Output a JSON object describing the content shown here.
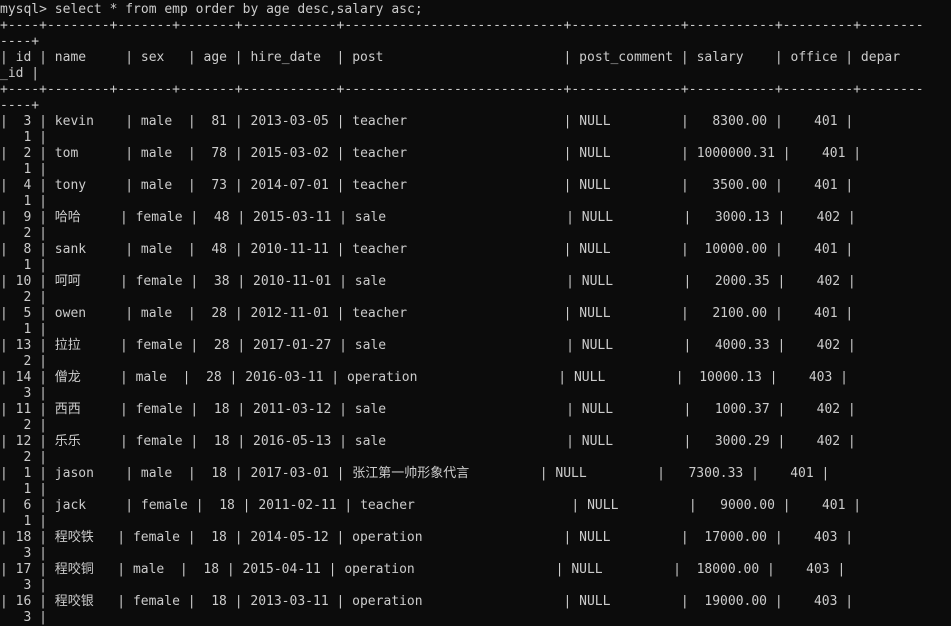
{
  "terminal": {
    "bg": "#0c0c0c",
    "fg": "#cccccc",
    "command": "mysql> select * from emp order by age desc,salary asc;"
  },
  "table": {
    "border_top": "+----+--------+-------+-------+------------+----------------------------+--------------+-----------+---------+--------",
    "border_wrap": "----+",
    "header": {
      "line1": "| id | name     | sex   | age | hire_date  | post                       | post_comment | salary    | office | depar",
      "line2": "_id |"
    },
    "rows": [
      {
        "id": "3",
        "name": "kevin",
        "sex": "male",
        "age": "81",
        "hire_date": "2013-03-05",
        "post": "teacher",
        "post_comment": "NULL",
        "salary": "8300.00",
        "office": "401",
        "depart_id": "1"
      },
      {
        "id": "2",
        "name": "tom",
        "sex": "male",
        "age": "78",
        "hire_date": "2015-03-02",
        "post": "teacher",
        "post_comment": "NULL",
        "salary": "1000000.31",
        "office": "401",
        "depart_id": "1"
      },
      {
        "id": "4",
        "name": "tony",
        "sex": "male",
        "age": "73",
        "hire_date": "2014-07-01",
        "post": "teacher",
        "post_comment": "NULL",
        "salary": "3500.00",
        "office": "401",
        "depart_id": "1"
      },
      {
        "id": "9",
        "name": "哈哈",
        "sex": "female",
        "age": "48",
        "hire_date": "2015-03-11",
        "post": "sale",
        "post_comment": "NULL",
        "salary": "3000.13",
        "office": "402",
        "depart_id": "2"
      },
      {
        "id": "8",
        "name": "sank",
        "sex": "male",
        "age": "48",
        "hire_date": "2010-11-11",
        "post": "teacher",
        "post_comment": "NULL",
        "salary": "10000.00",
        "office": "401",
        "depart_id": "1"
      },
      {
        "id": "10",
        "name": "呵呵",
        "sex": "female",
        "age": "38",
        "hire_date": "2010-11-01",
        "post": "sale",
        "post_comment": "NULL",
        "salary": "2000.35",
        "office": "402",
        "depart_id": "2"
      },
      {
        "id": "5",
        "name": "owen",
        "sex": "male",
        "age": "28",
        "hire_date": "2012-11-01",
        "post": "teacher",
        "post_comment": "NULL",
        "salary": "2100.00",
        "office": "401",
        "depart_id": "1"
      },
      {
        "id": "13",
        "name": "拉拉",
        "sex": "female",
        "age": "28",
        "hire_date": "2017-01-27",
        "post": "sale",
        "post_comment": "NULL",
        "salary": "4000.33",
        "office": "402",
        "depart_id": "2"
      },
      {
        "id": "14",
        "name": "僧龙",
        "sex": "male",
        "age": "28",
        "hire_date": "2016-03-11",
        "post": "operation",
        "post_comment": "NULL",
        "salary": "10000.13",
        "office": "403",
        "depart_id": "3"
      },
      {
        "id": "11",
        "name": "西西",
        "sex": "female",
        "age": "18",
        "hire_date": "2011-03-12",
        "post": "sale",
        "post_comment": "NULL",
        "salary": "1000.37",
        "office": "402",
        "depart_id": "2"
      },
      {
        "id": "12",
        "name": "乐乐",
        "sex": "female",
        "age": "18",
        "hire_date": "2016-05-13",
        "post": "sale",
        "post_comment": "NULL",
        "salary": "3000.29",
        "office": "402",
        "depart_id": "2"
      },
      {
        "id": "1",
        "name": "jason",
        "sex": "male",
        "age": "18",
        "hire_date": "2017-03-01",
        "post": "张江第一帅形象代言",
        "post_comment": "NULL",
        "salary": "7300.33",
        "office": "401",
        "depart_id": "1"
      },
      {
        "id": "6",
        "name": "jack",
        "sex": "female",
        "age": "18",
        "hire_date": "2011-02-11",
        "post": "teacher",
        "post_comment": "NULL",
        "salary": "9000.00",
        "office": "401",
        "depart_id": "1"
      },
      {
        "id": "18",
        "name": "程咬铁",
        "sex": "female",
        "age": "18",
        "hire_date": "2014-05-12",
        "post": "operation",
        "post_comment": "NULL",
        "salary": "17000.00",
        "office": "403",
        "depart_id": "3"
      },
      {
        "id": "17",
        "name": "程咬铜",
        "sex": "male",
        "age": "18",
        "hire_date": "2015-04-11",
        "post": "operation",
        "post_comment": "NULL",
        "salary": "18000.00",
        "office": "403",
        "depart_id": "3"
      },
      {
        "id": "16",
        "name": "程咬银",
        "sex": "female",
        "age": "18",
        "hire_date": "2013-03-11",
        "post": "operation",
        "post_comment": "NULL",
        "salary": "19000.00",
        "office": "403",
        "depart_id": "3"
      }
    ]
  }
}
